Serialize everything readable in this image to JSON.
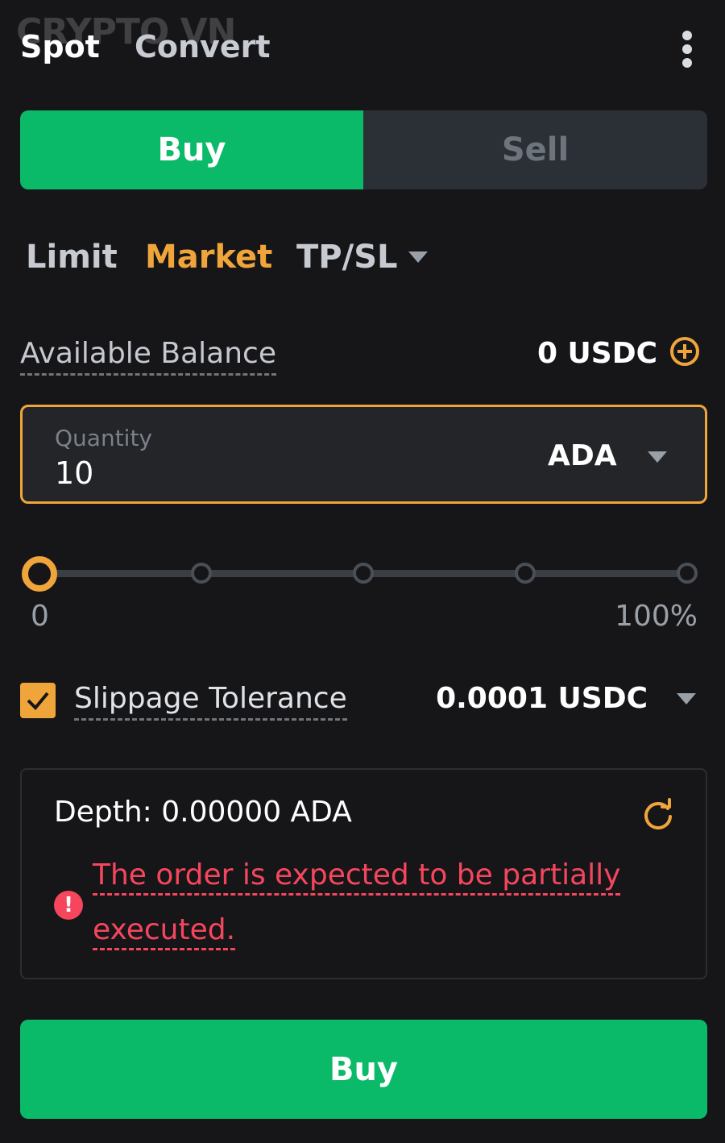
{
  "watermark": "CRYPTO VN",
  "header": {
    "tabs": [
      {
        "label": "Spot",
        "active": true
      },
      {
        "label": "Convert",
        "active": false
      }
    ],
    "more_icon": "more-vertical-icon"
  },
  "side_toggle": {
    "buy_label": "Buy",
    "sell_label": "Sell",
    "selected": "Buy"
  },
  "order_types": {
    "items": [
      "Limit",
      "Market",
      "TP/SL"
    ],
    "selected": "Market"
  },
  "balance": {
    "label": "Available Balance",
    "value": "0 USDC",
    "add_icon": "plus-circle-icon"
  },
  "quantity": {
    "label": "Quantity",
    "value": "10",
    "unit": "ADA"
  },
  "slider": {
    "min_label": "0",
    "max_label": "100%",
    "value_percent": 0,
    "stops": [
      0,
      25,
      50,
      75,
      100
    ]
  },
  "slippage": {
    "checked": true,
    "label": "Slippage Tolerance",
    "value": "0.0001 USDC"
  },
  "depth": {
    "text": "Depth: 0.00000 ADA",
    "warning_line1": "The order is expected to be partially",
    "warning_line2": "executed."
  },
  "submit": {
    "label": "Buy"
  },
  "colors": {
    "background": "#161619",
    "buy_green": "#0bba69",
    "accent_orange": "#f0a53a",
    "error_red": "#f6465d"
  }
}
